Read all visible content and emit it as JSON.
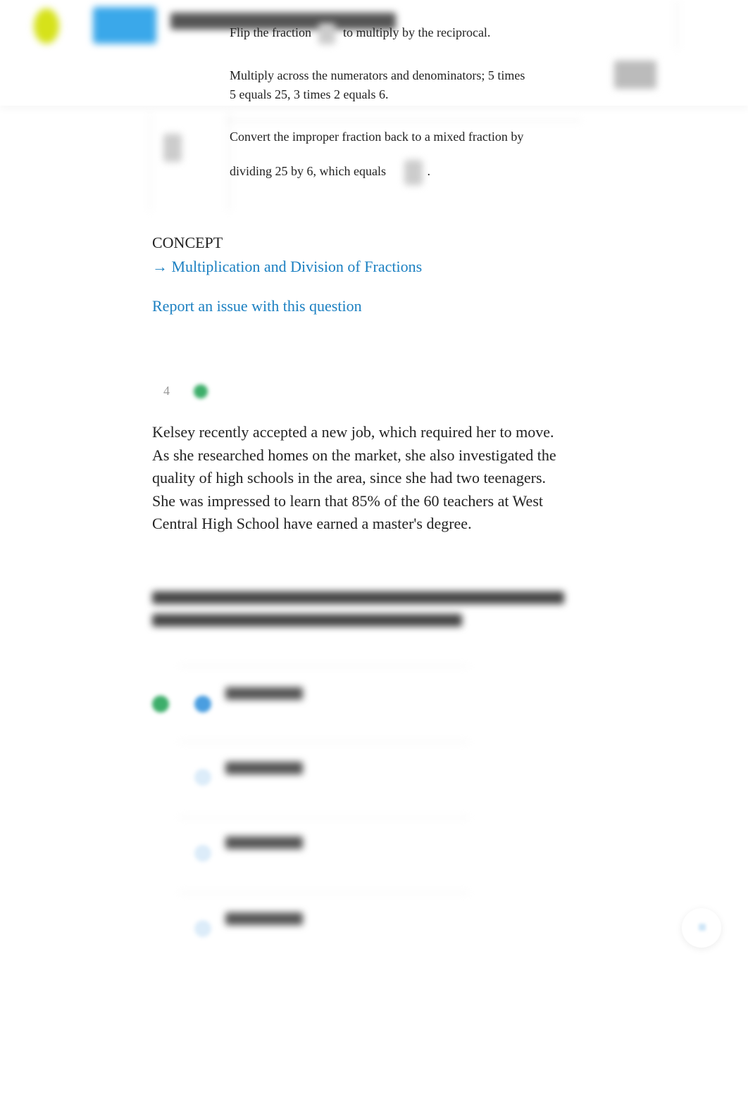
{
  "explanation": {
    "step1_before": "Flip the fraction",
    "step1_after": "to multiply by the reciprocal.",
    "step2": "Multiply across the numerators and denominators; 5 times 5 equals 25, 3 times 2 equals 6.",
    "step3_line1": "Convert the improper fraction back to a mixed fraction by",
    "step3_line2": "dividing 25 by 6, which equals",
    "step3_end": "."
  },
  "concept": {
    "label": "CONCEPT",
    "link": "→ Multiplication and Division of Fractions"
  },
  "report_link": "Report an issue with this question",
  "question": {
    "number": "4",
    "text": "Kelsey recently accepted a new job, which required her to move. As she researched homes on the market, she also investigated the quality of high schools in the area, since she had two teenagers. She was impressed to learn that 85% of the 60 teachers at West Central High School have earned a master's degree."
  },
  "colors": {
    "link": "#1a7fc1",
    "correct": "#3dae6a",
    "selected": "#4a9ee0",
    "logo": "#d6e21a",
    "header_button": "#3aa8ea"
  },
  "icons": {
    "correct_badge": "check-circle-icon",
    "scroll_top": "arrow-up-icon"
  }
}
